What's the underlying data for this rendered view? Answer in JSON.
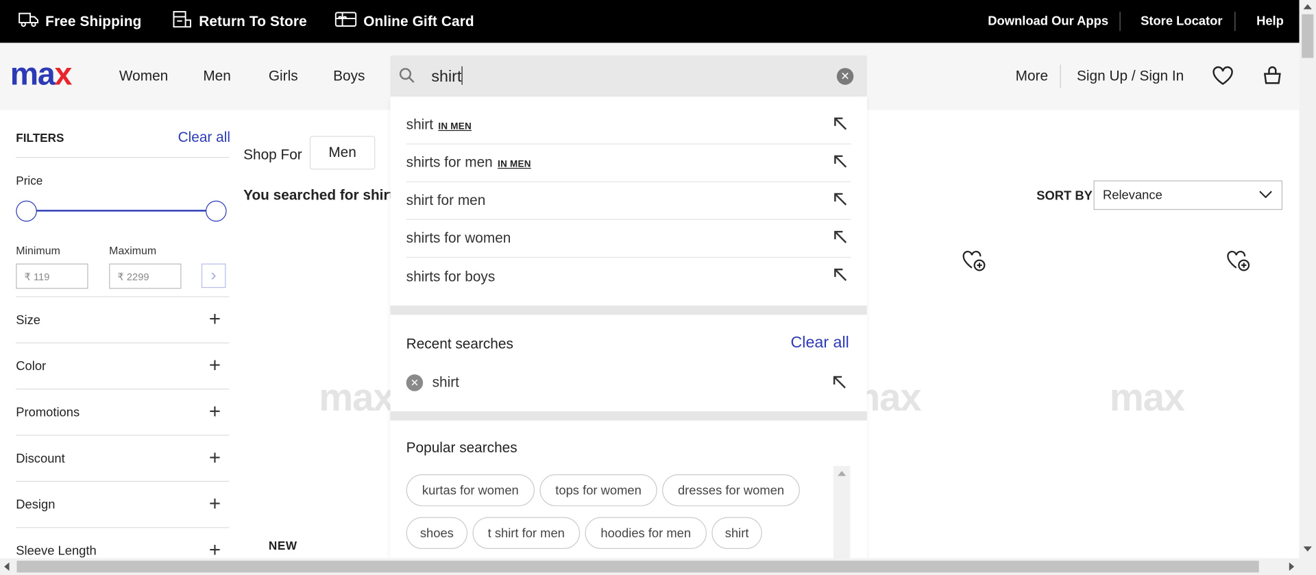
{
  "colors": {
    "accent": "#2c3ab5",
    "logo_m": "#2c3ab5",
    "logo_ax": "#e8262e",
    "topbar_bg": "#000000",
    "header_bg": "#f6f6f6"
  },
  "topbar": {
    "promos": [
      {
        "icon": "truck-icon",
        "label": "Free Shipping"
      },
      {
        "icon": "store-icon",
        "label": "Return To Store"
      },
      {
        "icon": "gift-card-icon",
        "label": "Online Gift Card"
      }
    ],
    "links": [
      "Download Our Apps",
      "Store Locator",
      "Help"
    ]
  },
  "header": {
    "logo_text": "max",
    "nav": [
      "Women",
      "Men",
      "Girls",
      "Boys"
    ],
    "search": {
      "value": "shirt",
      "icon": "search-icon"
    },
    "more": "More",
    "signin": "Sign Up / Sign In",
    "wishlist_icon": "heart-icon",
    "bag_icon": "bag-icon"
  },
  "filters": {
    "title": "FILTERS",
    "clear_all": "Clear all",
    "price": {
      "label": "Price",
      "min_label": "Minimum",
      "max_label": "Maximum",
      "min_placeholder": "₹ 119",
      "max_placeholder": "₹ 2299"
    },
    "groups": [
      "Size",
      "Color",
      "Promotions",
      "Discount",
      "Design",
      "Sleeve Length"
    ]
  },
  "main": {
    "shop_for_label": "Shop For",
    "shop_for_chip": "Men",
    "searched_text": "You searched for shirt",
    "sort_label": "SORT BY",
    "sort_value": "Relevance",
    "placeholder_logo": "max",
    "new_tag": "NEW"
  },
  "dropdown": {
    "suggestions": [
      {
        "text": "shirt",
        "context": "IN MEN"
      },
      {
        "text": "shirts for men",
        "context": "IN MEN"
      },
      {
        "text": "shirt for men",
        "context": ""
      },
      {
        "text": "shirts for women",
        "context": ""
      },
      {
        "text": "shirts for boys",
        "context": ""
      }
    ],
    "recent_title": "Recent searches",
    "recent_clear": "Clear all",
    "recent": [
      "shirt"
    ],
    "popular_title": "Popular searches",
    "popular": [
      "kurtas for women",
      "tops for women",
      "dresses for women",
      "shoes",
      "t shirt for men",
      "hoodies for men",
      "shirt"
    ]
  }
}
